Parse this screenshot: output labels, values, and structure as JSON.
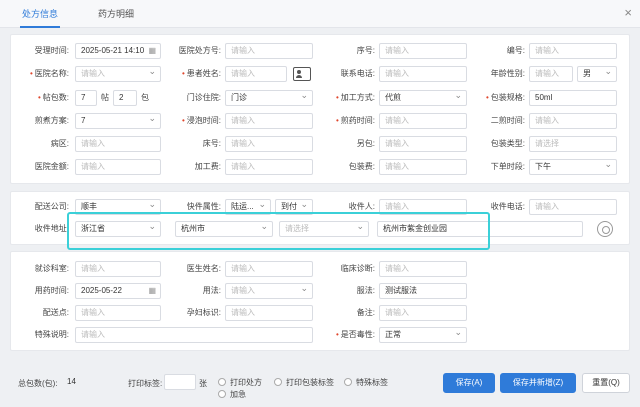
{
  "tabs": [
    "处方信息",
    "药方明细"
  ],
  "close_symbol": "×",
  "colors": {
    "accent": "#2f7bd9",
    "required": "#e0462c",
    "highlight": "#3bd0d8"
  },
  "form": {
    "accept_time_label": "受理时间:",
    "accept_time_value": "2025-05-21 14:10",
    "hospital_rx_no_label": "医院处方号:",
    "hospital_rx_no_placeholder": "请输入",
    "seq_label": "序号:",
    "seq_placeholder": "请输入",
    "code_label": "编号:",
    "code_placeholder": "请输入",
    "hospital_name_label": "医院名称:",
    "hospital_name_placeholder": "请输入",
    "patient_name_label": "患者姓名:",
    "patient_name_placeholder": "请输入",
    "phone_label": "联系电话:",
    "phone_placeholder": "请输入",
    "age_gender_label": "年龄性别:",
    "age_placeholder": "请输入",
    "gender_value": "男",
    "packs_label": "帖包数:",
    "packs_value": "7",
    "tie_unit": "帖",
    "bag_value": "2",
    "bag_unit": "包",
    "clinic_label": "门诊住院:",
    "clinic_value": "门诊",
    "process_label": "加工方式:",
    "process_value": "代煎",
    "pack_spec_label": "包装规格:",
    "pack_spec_value": "50ml",
    "dose_label": "煎煮方案:",
    "dose_value": "7",
    "soak_label": "浸泡时间:",
    "soak_placeholder": "请输入",
    "decoct1_label": "煎药时间:",
    "decoct1_placeholder": "请输入",
    "decoct2_label": "二煎时间:",
    "decoct2_placeholder": "请输入",
    "ward_label": "病区:",
    "ward_placeholder": "请输入",
    "bed_label": "床号:",
    "bed_placeholder": "请输入",
    "extra_label": "另包:",
    "extra_placeholder": "请输入",
    "pack_type_label": "包装类型:",
    "pack_type_placeholder": "请选择",
    "amount_label": "医院金额:",
    "amount_placeholder": "请输入",
    "process_fee_label": "加工费:",
    "process_fee_placeholder": "请输入",
    "pack_fee_label": "包装费:",
    "pack_fee_placeholder": "请输入",
    "order_period_label": "下单时段:",
    "order_period_value": "下午"
  },
  "delivery": {
    "company_label": "配送公司:",
    "company_value": "顺丰",
    "express_attr_label": "快件属性:",
    "express_attr_value": "陆运...",
    "express_type_value": "到付",
    "receiver_label": "收件人:",
    "receiver_placeholder": "请输入",
    "receiver_phone_label": "收件电话:",
    "receiver_phone_placeholder": "请输入",
    "address_label": "收件地址:",
    "province": "浙江省",
    "city": "杭州市",
    "district_placeholder": "请选择",
    "detail": "杭州市紫金创业园"
  },
  "clinical": {
    "room_label": "就诊科室:",
    "room_placeholder": "请输入",
    "doctor_label": "医生姓名:",
    "doctor_placeholder": "请输入",
    "diagnosis_label": "临床诊断:",
    "diagnosis_placeholder": "请输入",
    "med_time_label": "用药时间:",
    "med_time_value": "2025-05-22",
    "usage_label": "用法:",
    "usage_placeholder": "请输入",
    "method_label": "服法:",
    "method_value": "测试服法",
    "point_label": "配送点:",
    "point_placeholder": "请输入",
    "pregnancy_label": "孕妇标识:",
    "pregnancy_placeholder": "请输入",
    "remark_label": "备注:",
    "remark_placeholder": "请输入",
    "special_label": "特殊说明:",
    "special_placeholder": "请输入",
    "toxic_label": "是否毒性:",
    "toxic_value": "正常"
  },
  "footer": {
    "total_label": "总包数(包):",
    "total_value": "14",
    "print_label": "打印标签:",
    "print_unit": "张",
    "opt_print_rx": "打印处方",
    "opt_print_pack": "打印包装标签",
    "opt_special": "特殊标签",
    "opt_urgent": "加急",
    "save": "保存(A)",
    "save_new": "保存并新增(Z)",
    "reset": "重置(Q)"
  }
}
